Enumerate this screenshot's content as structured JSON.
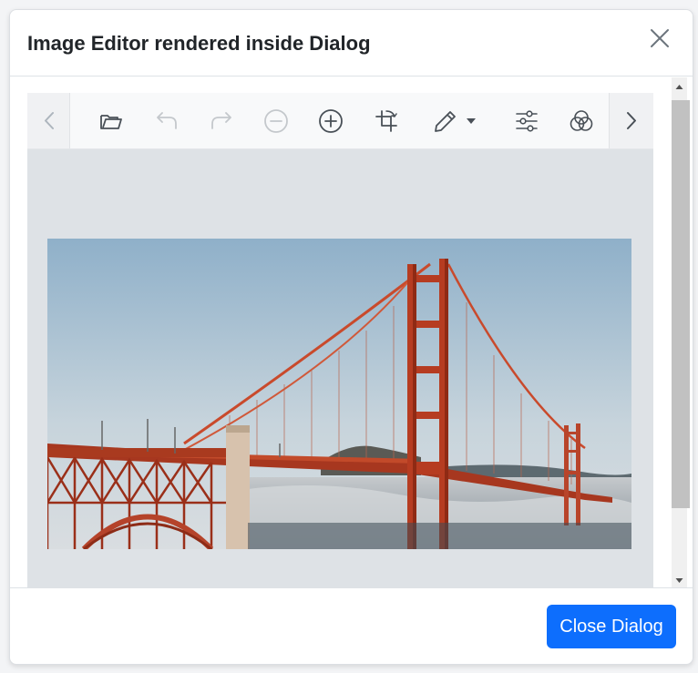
{
  "dialog": {
    "title": "Image Editor rendered inside Dialog",
    "close_icon": "close-icon",
    "footer_button_label": "Close Dialog"
  },
  "toolbar": {
    "items": [
      {
        "name": "open",
        "icon": "folder-open-icon",
        "enabled": true
      },
      {
        "name": "undo",
        "icon": "undo-icon",
        "enabled": false
      },
      {
        "name": "redo",
        "icon": "redo-icon",
        "enabled": false
      },
      {
        "name": "zoom-out",
        "icon": "zoom-out-icon",
        "enabled": false
      },
      {
        "name": "zoom-in",
        "icon": "zoom-in-icon",
        "enabled": true
      },
      {
        "name": "crop",
        "icon": "crop-icon",
        "enabled": true
      },
      {
        "name": "annotate",
        "icon": "pencil-icon",
        "enabled": true,
        "has_dropdown": true
      },
      {
        "name": "adjust",
        "icon": "sliders-icon",
        "enabled": true
      },
      {
        "name": "filters",
        "icon": "filters-icon",
        "enabled": true
      }
    ],
    "nav_left_icon": "chevron-left-icon",
    "nav_right_icon": "chevron-right-icon"
  },
  "colors": {
    "primary": "#0d6efd",
    "toolbar_bg": "#f8f9fa",
    "canvas_bg": "#dee2e6",
    "icon_active": "#495057",
    "icon_disabled": "#c4c8cc"
  },
  "image": {
    "subject": "Golden Gate Bridge"
  }
}
